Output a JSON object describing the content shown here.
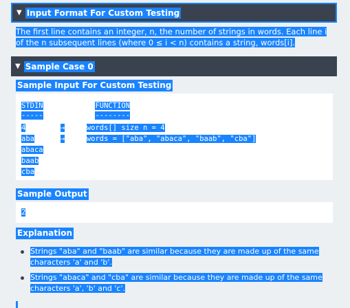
{
  "input_format": {
    "title": "Input Format For Custom Testing",
    "line1": "The first line contains an integer, n, the number of strings in words. Each line i",
    "line2": "of the n subsequent lines (where 0 ≤ i < n) contains a string, words[i]."
  },
  "sample_case": {
    "title": "Sample Case 0",
    "input_label": "Sample Input For Custom Testing",
    "code_header": {
      "left": "STDIN",
      "right": "FUNCTION"
    },
    "code_divider": {
      "left": "-----",
      "right": "--------"
    },
    "code_rows": [
      {
        "left": "4",
        "arrow": "→",
        "right": "words[] size n = 4"
      },
      {
        "left": "aba",
        "arrow": "→",
        "right": "words = [\"aba\", \"abaca\", \"baab\", \"cba\"]"
      },
      {
        "left": "abaca"
      },
      {
        "left": "baab"
      },
      {
        "left": "cba"
      }
    ],
    "output_label": "Sample Output",
    "output_value": "2",
    "explanation_label": "Explanation",
    "explanation_items": [
      "Strings \"aba\" and \"baab\" are similar because they are made up of the same characters 'a' and 'b'.",
      "Strings \"abaca\" and \"cba\" are similar because they are made up of the same characters 'a', 'b' and 'c'."
    ]
  },
  "colors": {
    "header_bg": "#39424e",
    "selection": "#1a84ff",
    "page_bg": "#edf0f3"
  },
  "icons": {
    "toggle": "triangle-down-icon",
    "arrow": "right-arrow-icon"
  }
}
